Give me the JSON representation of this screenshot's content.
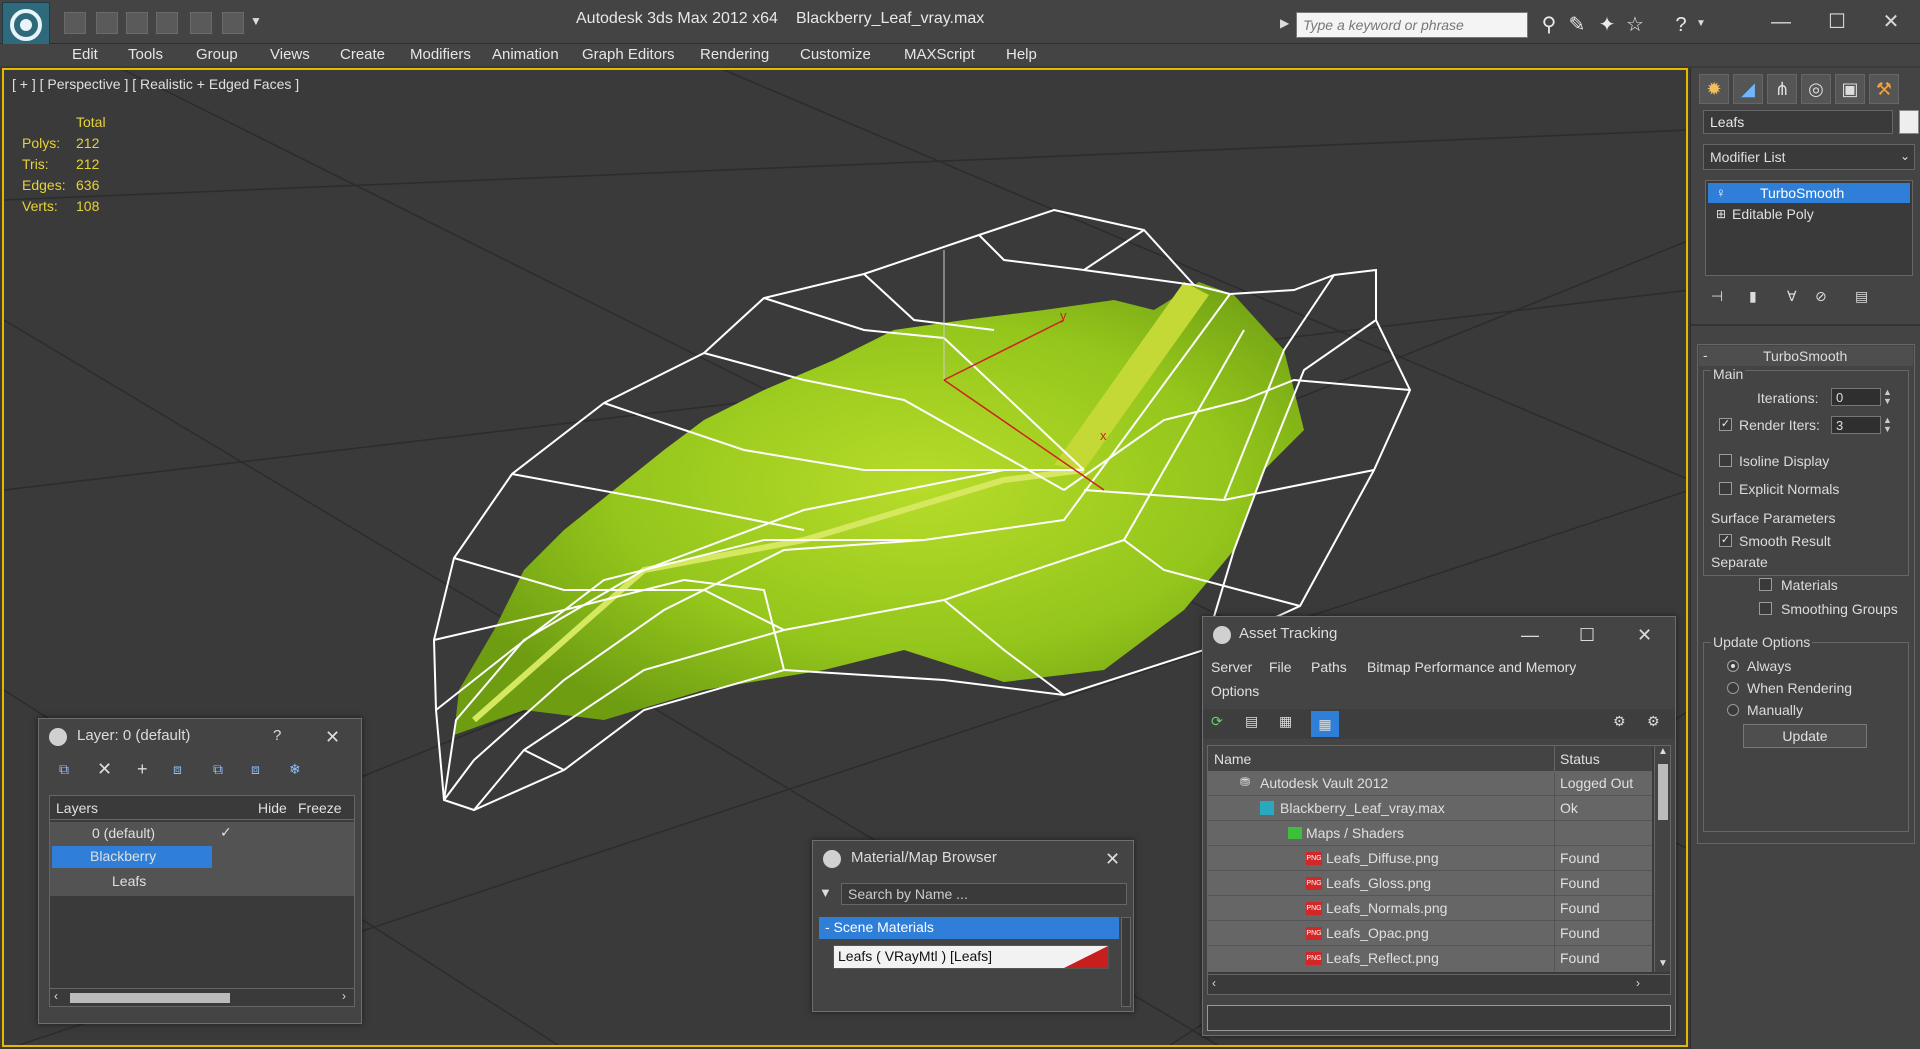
{
  "titlebar": {
    "app_title": "Autodesk 3ds Max  2012 x64",
    "file_name": "Blackberry_Leaf_vray.max",
    "search_placeholder": "Type a keyword or phrase"
  },
  "menu": [
    "Edit",
    "Tools",
    "Group",
    "Views",
    "Create",
    "Modifiers",
    "Animation",
    "Graph Editors",
    "Rendering",
    "Customize",
    "MAXScript",
    "Help"
  ],
  "viewport": {
    "label": "[ + ] [ Perspective ] [ Realistic + Edged Faces ]",
    "stats_header": "Total",
    "stats": [
      {
        "label": "Polys:",
        "value": "212"
      },
      {
        "label": "Tris:",
        "value": "212"
      },
      {
        "label": "Edges:",
        "value": "636"
      },
      {
        "label": "Verts:",
        "value": "108"
      }
    ],
    "axis_x": "x",
    "axis_y": "y"
  },
  "command_panel": {
    "object_name": "Leafs",
    "modifier_list": "Modifier List",
    "stack": [
      "TurboSmooth",
      "Editable Poly"
    ],
    "rollout_title": "TurboSmooth",
    "main_group": "Main",
    "iterations_label": "Iterations:",
    "iterations_value": "0",
    "render_iters_label": "Render Iters:",
    "render_iters_value": "3",
    "isoline_label": "Isoline Display",
    "explicit_normals_label": "Explicit Normals",
    "surface_group": "Surface Parameters",
    "smooth_result_label": "Smooth Result",
    "separate_label": "Separate",
    "materials_label": "Materials",
    "smoothing_groups_label": "Smoothing Groups",
    "update_group": "Update Options",
    "always_label": "Always",
    "when_rendering_label": "When Rendering",
    "manually_label": "Manually",
    "update_button": "Update"
  },
  "layer_window": {
    "title": "Layer: 0 (default)",
    "help": "?",
    "columns": [
      "Layers",
      "Hide",
      "Freeze"
    ],
    "rows": [
      "0 (default)",
      "Blackberry",
      "Leafs"
    ]
  },
  "material_browser": {
    "title": "Material/Map Browser",
    "search_placeholder": "Search by Name ...",
    "group": "- Scene Materials",
    "item": "Leafs  ( VRayMtl )  [Leafs]"
  },
  "asset_tracking": {
    "title": "Asset Tracking",
    "menu": [
      "Server",
      "File",
      "Paths",
      "Bitmap Performance and Memory",
      "Options"
    ],
    "columns": [
      "Name",
      "Status"
    ],
    "rows": [
      {
        "name": "Autodesk Vault 2012",
        "status": "Logged Out"
      },
      {
        "name": "Blackberry_Leaf_vray.max",
        "status": "Ok"
      },
      {
        "name": "Maps / Shaders",
        "status": ""
      },
      {
        "name": "Leafs_Diffuse.png",
        "status": "Found"
      },
      {
        "name": "Leafs_Gloss.png",
        "status": "Found"
      },
      {
        "name": "Leafs_Normals.png",
        "status": "Found"
      },
      {
        "name": "Leafs_Opac.png",
        "status": "Found"
      },
      {
        "name": "Leafs_Reflect.png",
        "status": "Found"
      }
    ]
  },
  "colors": {
    "viewport_border": "#e6b800",
    "selection_blue": "#2f7fd8",
    "stats_yellow": "#e6d23a",
    "leaf_green": "#9acd1e"
  }
}
